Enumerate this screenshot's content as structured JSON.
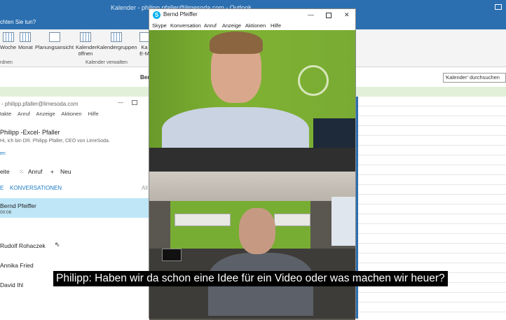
{
  "outlook": {
    "title": "Kalender - philipp.pfaller@limesoda.com - Outlook",
    "tell_me": "chten Sie tun?",
    "ribbon": {
      "buttons": [
        "Woche",
        "Monat",
        "Planungsansicht",
        "Kalender öffnen",
        "Kalendergruppen",
        "Ka E-M"
      ],
      "groups": [
        "rdnen",
        "Kalender verwalten"
      ]
    },
    "calendar_title": "Ber",
    "search_placeholder": "'Kalender' durchsuchen"
  },
  "skype_main": {
    "title": "- philipp.pfaller@limesoda.com",
    "menu": [
      "takte",
      "Anruf",
      "Anzeige",
      "Aktionen",
      "Hilfe"
    ],
    "profile": {
      "name": "Philipp -Excel- Pfaller",
      "mood": "Hi, ich bin DR. Philipp Pfaller, CEO von LimeSoda.",
      "cut": "en"
    },
    "actions": [
      "eite",
      "Anruf",
      "Neu"
    ],
    "tabs": [
      "E",
      "KONVERSATIONEN",
      "All"
    ],
    "contacts": [
      {
        "name": "Bernd Pfeiffer",
        "time": "00:06"
      },
      {
        "name": "Rudolf Rohaczek",
        "time": ""
      },
      {
        "name": "Annika Fried",
        "time": ""
      },
      {
        "name": "David Ihl",
        "time": ""
      }
    ]
  },
  "call_window": {
    "title": "Bernd Pfeiffer",
    "menu": [
      "Skype",
      "Konversation",
      "Anruf",
      "Anzeige",
      "Aktionen",
      "Hilfe"
    ]
  },
  "subtitle": "Philipp: Haben wir da schon eine Idee für ein Video oder was machen wir heuer?"
}
